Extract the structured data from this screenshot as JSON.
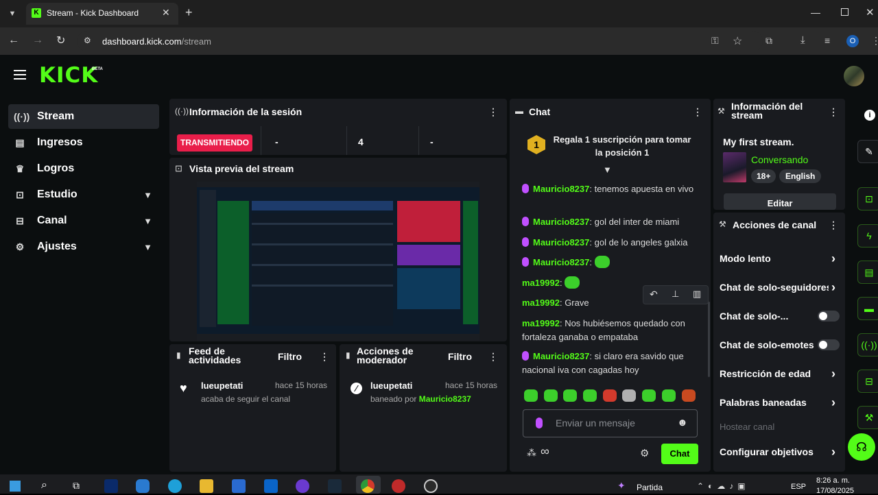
{
  "browser": {
    "tab_title": "Stream - Kick Dashboard",
    "new_tab": "+",
    "url_domain": "dashboard.kick.com",
    "url_path": "/stream",
    "profile_initial": "O"
  },
  "header": {
    "logo": "KICK",
    "beta": "BETA"
  },
  "sidebar": {
    "items": [
      {
        "label": "Stream"
      },
      {
        "label": "Ingresos"
      },
      {
        "label": "Logros"
      },
      {
        "label": "Estudio"
      },
      {
        "label": "Canal"
      },
      {
        "label": "Ajustes"
      }
    ]
  },
  "session": {
    "title": "Información de la sesión",
    "status": "TRANSMITIENDO",
    "stats": [
      "-",
      "4",
      "-"
    ]
  },
  "preview": {
    "title": "Vista previa del stream"
  },
  "feed": {
    "title": "Feed de actividades",
    "filter": "Filtro",
    "user": "lueupetati",
    "time": "hace 15 horas",
    "action": "acaba de seguir el canal"
  },
  "mod": {
    "title": "Acciones de moderador",
    "filter": "Filtro",
    "user": "lueupetati",
    "time": "hace 15 horas",
    "action_prefix": "baneado por",
    "moderator": "Mauricio8237"
  },
  "chat": {
    "title": "Chat",
    "sub_badge": "1",
    "sub_text": "Regala 1 suscripción para tomar la posición 1",
    "messages": [
      {
        "user": "Mauricio8237",
        "text": "tenemos apuesta en vivo"
      },
      {
        "user": "Mauricio8237",
        "text": "gol del inter de miami"
      },
      {
        "user": "Mauricio8237",
        "text": "gol de lo angeles galxia"
      },
      {
        "user": "Mauricio8237",
        "text": ""
      },
      {
        "user": "ma19992",
        "text": ""
      },
      {
        "user": "ma19992",
        "text": "Grave"
      },
      {
        "user": "ma19992",
        "text": "Nos hubiésemos quedado con fortaleza ganaba o empataba"
      },
      {
        "user": "Mauricio8237",
        "text": "si claro era savido que nacional iva con cagadas hoy"
      }
    ],
    "placeholder": "Enviar un mensaje",
    "infinity": "∞",
    "send_label": "Chat"
  },
  "stream_info": {
    "title": "Información del stream",
    "stream_title": "My first stream.",
    "category": "Conversando",
    "tags": [
      "18+",
      "English"
    ],
    "edit": "Editar"
  },
  "channel_actions": {
    "title": "Acciones de canal",
    "items": [
      {
        "label": "Modo lento"
      },
      {
        "label": "Chat de solo-seguidores"
      },
      {
        "label": "Chat de solo-..."
      },
      {
        "label": "Chat de solo-emotes"
      },
      {
        "label": "Restricción de edad"
      },
      {
        "label": "Palabras baneadas"
      },
      {
        "label": "Hostear canal"
      },
      {
        "label": "Configurar objetivos"
      }
    ]
  },
  "taskbar": {
    "weather": "Partida",
    "lang": "ESP",
    "time": "8:26 a. m.",
    "date": "17/08/2025"
  },
  "colors": {
    "brand": "#53fc18",
    "live": "#e91e4a",
    "panel": "#191b1f",
    "page": "#0b0e0f"
  }
}
